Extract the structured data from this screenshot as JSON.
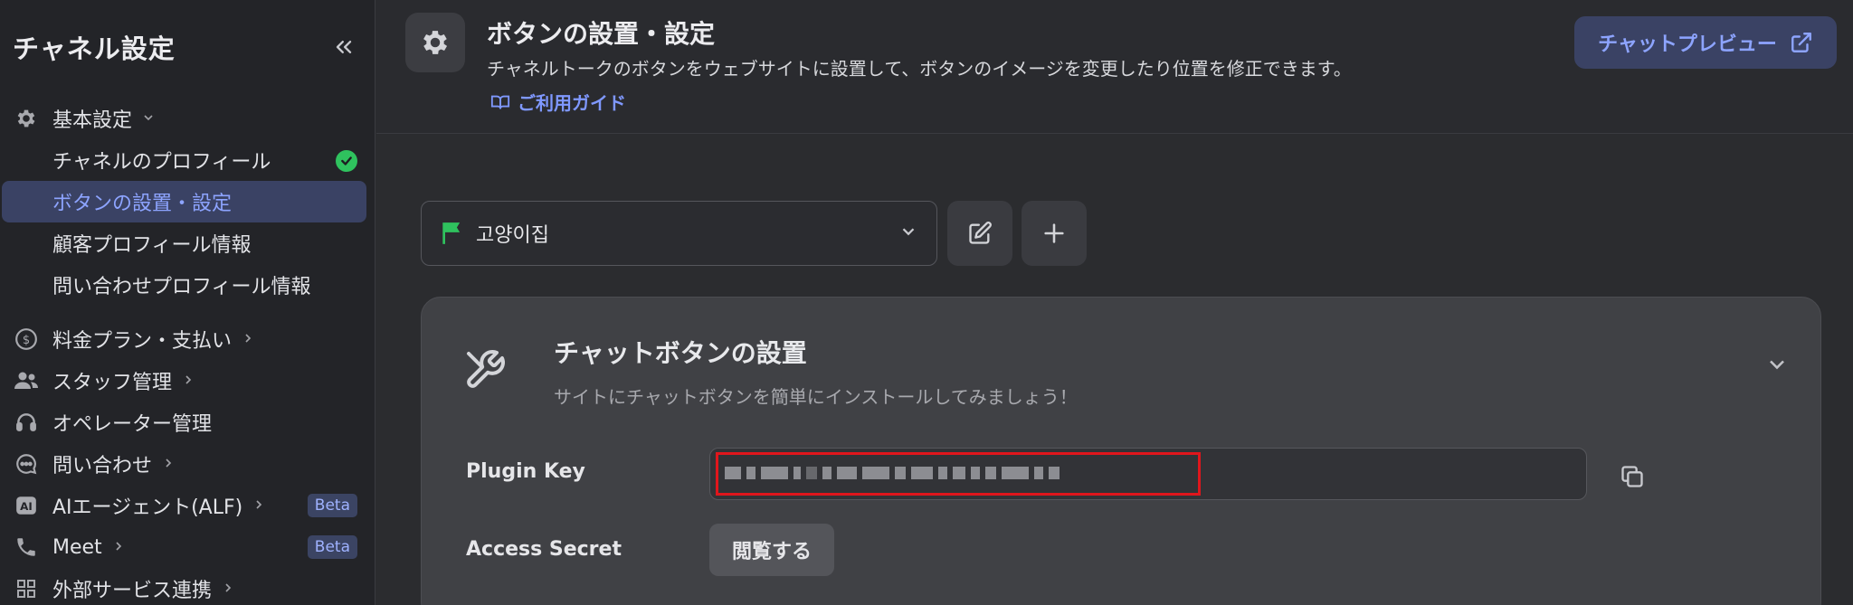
{
  "sidebar": {
    "title": "チャネル設定",
    "basic_settings": {
      "label": "基本設定"
    },
    "sub_items": [
      {
        "label": "チャネルのプロフィール"
      },
      {
        "label": "ボタンの設置・設定"
      },
      {
        "label": "顧客プロフィール情報"
      },
      {
        "label": "問い合わせプロフィール情報"
      }
    ],
    "items": [
      {
        "label": "料金プラン・支払い",
        "icon": "dollar-circle-icon"
      },
      {
        "label": "スタッフ管理",
        "icon": "users-icon"
      },
      {
        "label": "オペレーター管理",
        "icon": "headset-icon"
      },
      {
        "label": "問い合わせ",
        "icon": "chat-bubble-icon"
      },
      {
        "label": "AIエージェント(ALF)",
        "icon": "ai-icon",
        "badge": "Beta"
      },
      {
        "label": "Meet",
        "icon": "phone-icon",
        "badge": "Beta"
      },
      {
        "label": "外部サービス連携",
        "icon": "grid-icon"
      }
    ]
  },
  "header": {
    "title": "ボタンの設置・設定",
    "description": "チャネルトークのボタンをウェブサイトに設置して、ボタンのイメージを変更したり位置を修正できます。",
    "guide_link": "ご利用ガイド",
    "preview_button": "チャットプレビュー"
  },
  "selector": {
    "value": "고양이집",
    "flag_color": "#2fc25e"
  },
  "card": {
    "title": "チャットボタンの設置",
    "subtitle": "サイトにチャットボタンを簡単にインストールしてみましょう！",
    "plugin_key_label": "Plugin Key",
    "access_secret_label": "Access Secret",
    "view_button": "閲覧する"
  },
  "colors": {
    "accent": "#8da4ff",
    "highlight_border": "#e0161c",
    "success": "#2fc25e"
  }
}
